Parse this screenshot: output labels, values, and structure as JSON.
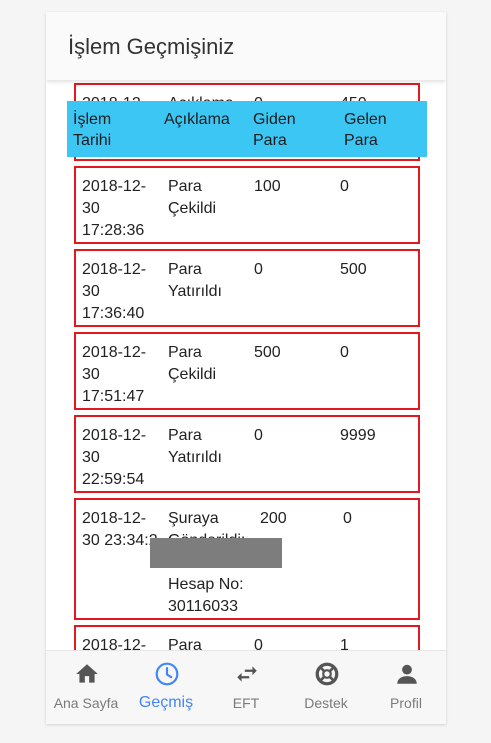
{
  "header": {
    "title": "İşlem Geçmişiniz"
  },
  "columns": {
    "date": "İşlem Tarihi",
    "desc": "Açıklama",
    "out": "Giden Para",
    "in": "Gelen Para"
  },
  "rows": [
    {
      "date": "2018-12-30",
      "desc": "Açıklama",
      "out": "0",
      "in": "450"
    },
    {
      "date": "2018-12-30 17:28:36",
      "desc": "Para Çekildi",
      "out": "100",
      "in": "0"
    },
    {
      "date": "2018-12-30 17:36:40",
      "desc": "Para Yatırıldı",
      "out": "0",
      "in": "500"
    },
    {
      "date": "2018-12-30 17:51:47",
      "desc": "Para Çekildi",
      "out": "500",
      "in": "0"
    },
    {
      "date": "2018-12-30 22:59:54",
      "desc": "Para Yatırıldı",
      "out": "0",
      "in": "9999"
    },
    {
      "date": "2018-12-30 23:34:2",
      "desc": "Şuraya Gönderildi:",
      "desc2": "Hesap No: 30116033",
      "out": "200",
      "in": "0"
    },
    {
      "date": "2018-12-",
      "desc": "Para",
      "out": "0",
      "in": "1"
    }
  ],
  "nav": {
    "home": "Ana Sayfa",
    "history": "Geçmiş",
    "eft": "EFT",
    "support": "Destek",
    "profile": "Profil"
  },
  "colors": {
    "accent": "#4285f4",
    "header_band": "#3cc6f4",
    "row_border": "#e0191e"
  }
}
